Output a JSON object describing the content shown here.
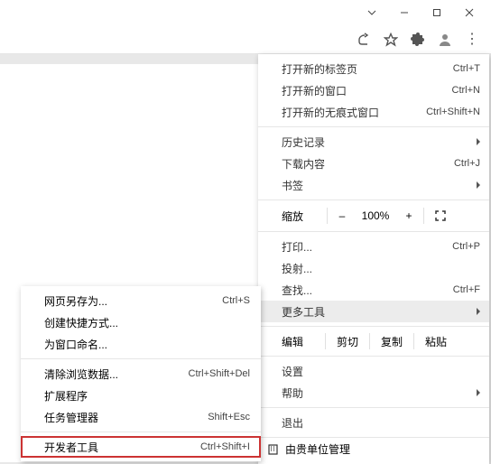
{
  "titlebar": {},
  "mainMenu": {
    "newTab": {
      "label": "打开新的标签页",
      "hint": "Ctrl+T"
    },
    "newWindow": {
      "label": "打开新的窗口",
      "hint": "Ctrl+N"
    },
    "newIncognito": {
      "label": "打开新的无痕式窗口",
      "hint": "Ctrl+Shift+N"
    },
    "history": {
      "label": "历史记录"
    },
    "downloads": {
      "label": "下载内容",
      "hint": "Ctrl+J"
    },
    "bookmarks": {
      "label": "书签"
    },
    "zoom": {
      "label": "缩放",
      "minus": "–",
      "value": "100%",
      "plus": "+"
    },
    "print": {
      "label": "打印...",
      "hint": "Ctrl+P"
    },
    "cast": {
      "label": "投射..."
    },
    "find": {
      "label": "查找...",
      "hint": "Ctrl+F"
    },
    "moreTools": {
      "label": "更多工具"
    },
    "edit": {
      "label": "编辑",
      "cut": "剪切",
      "copy": "复制",
      "paste": "粘贴"
    },
    "settings": {
      "label": "设置"
    },
    "help": {
      "label": "帮助"
    },
    "exit": {
      "label": "退出"
    },
    "managed": {
      "label": "由贵单位管理"
    }
  },
  "subMenu": {
    "savePageAs": {
      "label": "网页另存为...",
      "hint": "Ctrl+S"
    },
    "createShortcut": {
      "label": "创建快捷方式..."
    },
    "nameWindow": {
      "label": "为窗口命名..."
    },
    "clearBrowsing": {
      "label": "清除浏览数据...",
      "hint": "Ctrl+Shift+Del"
    },
    "extensions": {
      "label": "扩展程序"
    },
    "taskManager": {
      "label": "任务管理器",
      "hint": "Shift+Esc"
    },
    "devTools": {
      "label": "开发者工具",
      "hint": "Ctrl+Shift+I"
    }
  }
}
